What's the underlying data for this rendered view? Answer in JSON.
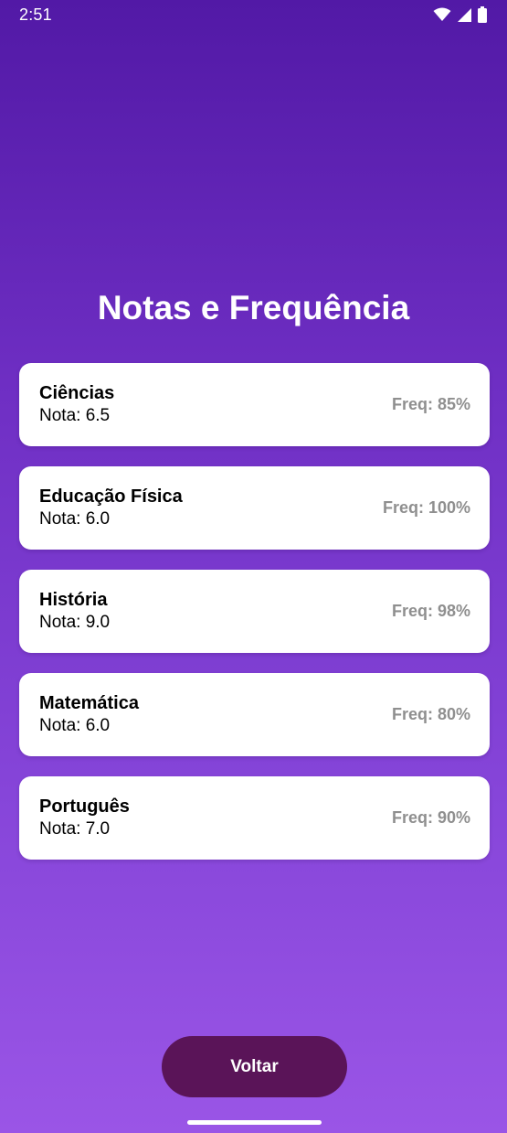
{
  "status_bar": {
    "time": "2:51",
    "icons": [
      "wifi-icon",
      "signal-icon",
      "battery-icon"
    ]
  },
  "page": {
    "title": "Notas e Frequência"
  },
  "subjects": [
    {
      "name": "Ciências",
      "grade": "Nota: 6.5",
      "frequency": "Freq: 85%"
    },
    {
      "name": "Educação Física",
      "grade": "Nota: 6.0",
      "frequency": "Freq: 100%"
    },
    {
      "name": "História",
      "grade": "Nota: 9.0",
      "frequency": "Freq: 98%"
    },
    {
      "name": "Matemática",
      "grade": "Nota: 6.0",
      "frequency": "Freq: 80%"
    },
    {
      "name": "Português",
      "grade": "Nota: 7.0",
      "frequency": "Freq: 90%"
    }
  ],
  "actions": {
    "back_label": "Voltar"
  },
  "colors": {
    "background_top": "#5219a6",
    "background_bottom": "#9a55e6",
    "button": "#5a1458",
    "card": "#ffffff",
    "freq_text": "#8f8f8f"
  }
}
